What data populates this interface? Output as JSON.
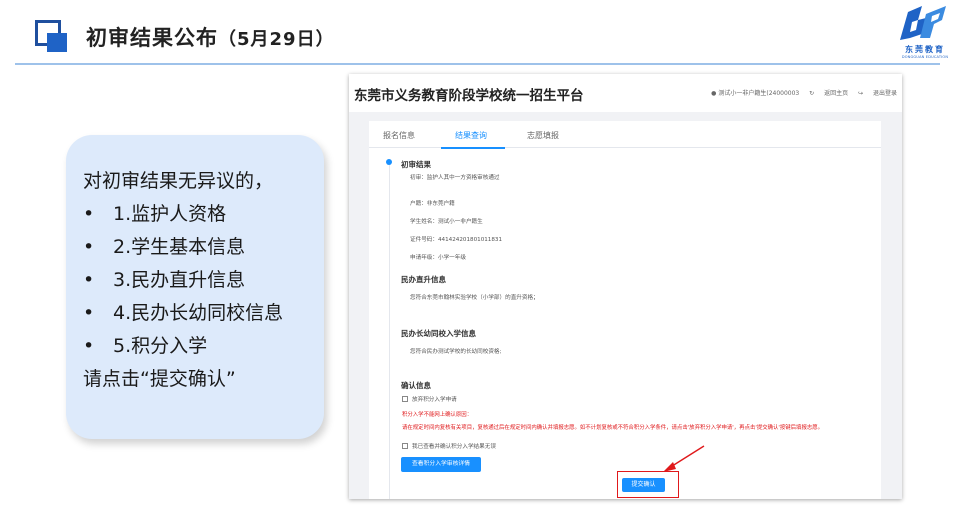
{
  "slide": {
    "title": "初审结果公布",
    "title_date": "（5月29日）",
    "logo_text": "东莞教育",
    "logo_sub": "DONGGUAN EDUCATION",
    "accent_color": "#1f63c6"
  },
  "callout": {
    "intro": "对初审结果无异议的，",
    "items": [
      "1.监护人资格",
      "2.学生基本信息",
      "3.民办直升信息",
      "4.民办长幼同校信息",
      "5.积分入学"
    ],
    "bullet": "•",
    "footer": "请点击“提交确认”"
  },
  "screenshot": {
    "site_title": "东莞市义务教育阶段学校统一招生平台",
    "user_label": "测试小一非户籍生(24000003",
    "home_link": "返回主页",
    "logout_link": "退出登录",
    "tabs": [
      "报名信息",
      "结果查询",
      "志愿填报"
    ],
    "active_tab": "结果查询",
    "result_section": {
      "title": "初审结果",
      "review_label": "初审：",
      "review_value": "监护人其中一方资格审核通过",
      "fields": [
        {
          "label": "户籍：",
          "value": "非东莞户籍"
        },
        {
          "label": "学生姓名：",
          "value": "测试小一非户籍生"
        },
        {
          "label": "证件号码：",
          "value": "441424201801011831"
        },
        {
          "label": "申请年级：",
          "value": "小学一年级"
        }
      ]
    },
    "direct_section": {
      "title": "民办直升信息",
      "text": "您符合东莞市翰林实验学校（小学部）的直升资格；"
    },
    "sibling_section": {
      "title": "民办长幼同校入学信息",
      "text": "您符合民办测试学校的长幼同校资格;"
    },
    "confirm_section": {
      "title": "确认信息",
      "checkbox_giveup": "放弃积分入学申请",
      "reason_label": "积分入学不能网上确认原因：",
      "reason_text": "请在规定时间内复核有关项目，复核通过后在规定时间内确认并填报志愿。如不计划复核或不符合积分入学条件，请点击'放弃积分入学申请'，再点击'提交确认'按键后填报志愿。",
      "checkbox_checked": "我已查看并确认积分入学结果无误",
      "detail_button": "查看积分入学审核详情",
      "submit_button": "提交确认"
    }
  }
}
